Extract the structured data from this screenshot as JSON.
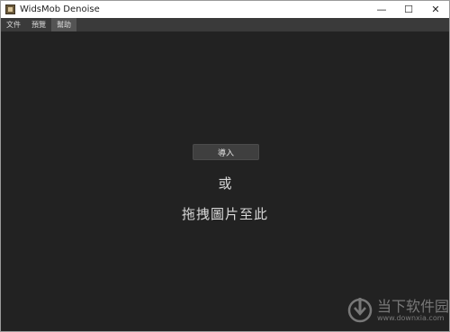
{
  "window": {
    "title": "WidsMob Denoise",
    "controls": {
      "minimize": "—",
      "maximize": "☐",
      "close": "✕"
    }
  },
  "menubar": {
    "items": [
      {
        "label": "文件",
        "active": false
      },
      {
        "label": "預覽",
        "active": false
      },
      {
        "label": "幫助",
        "active": true
      }
    ]
  },
  "main": {
    "import_button": "導入",
    "or_text": "或",
    "drag_hint": "拖拽圖片至此"
  },
  "watermark": {
    "title": "当下软件园",
    "url": "www.downxia.com",
    "logo_icon": "downxia-logo-icon"
  }
}
